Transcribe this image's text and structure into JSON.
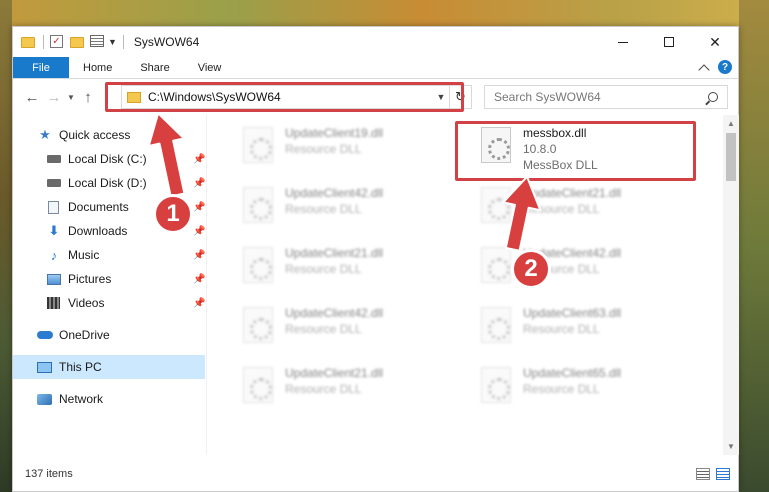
{
  "window": {
    "title": "SysWOW64"
  },
  "ribbon": {
    "tabs": [
      "File",
      "Home",
      "Share",
      "View"
    ],
    "help": "?"
  },
  "address": {
    "path": "C:\\Windows\\SysWOW64",
    "search_placeholder": "Search SysWOW64"
  },
  "sidebar": {
    "quick_access": "Quick access",
    "items": [
      {
        "label": "Local Disk (C:)"
      },
      {
        "label": "Local Disk (D:)"
      },
      {
        "label": "Documents"
      },
      {
        "label": "Downloads"
      },
      {
        "label": "Music"
      },
      {
        "label": "Pictures"
      },
      {
        "label": "Videos"
      }
    ],
    "onedrive": "OneDrive",
    "this_pc": "This PC",
    "network": "Network"
  },
  "files": {
    "left": [
      {
        "name": "UpdateClient19.dll",
        "type": "Resource DLL"
      },
      {
        "name": "UpdateClient42.dll",
        "type": "Resource DLL"
      },
      {
        "name": "UpdateClient21.dll",
        "type": "Resource DLL"
      },
      {
        "name": "UpdateClient42.dll",
        "type": "Resource DLL"
      },
      {
        "name": "UpdateClient21.dll",
        "type": "Resource DLL"
      }
    ],
    "highlighted": {
      "name": "messbox.dll",
      "version": "10.8.0",
      "type": "MessBox DLL"
    },
    "right": [
      {
        "name": "UpdateClient21.dll",
        "type": "Resource DLL"
      },
      {
        "name": "UpdateClient42.dll",
        "type": "Resource DLL"
      },
      {
        "name": "UpdateClient63.dll",
        "type": "Resource DLL"
      },
      {
        "name": "UpdateClient65.dll",
        "type": "Resource DLL"
      }
    ]
  },
  "status": {
    "count": "137 items"
  },
  "annotations": {
    "step1": "1",
    "step2": "2",
    "highlight_color": "#d14145"
  }
}
